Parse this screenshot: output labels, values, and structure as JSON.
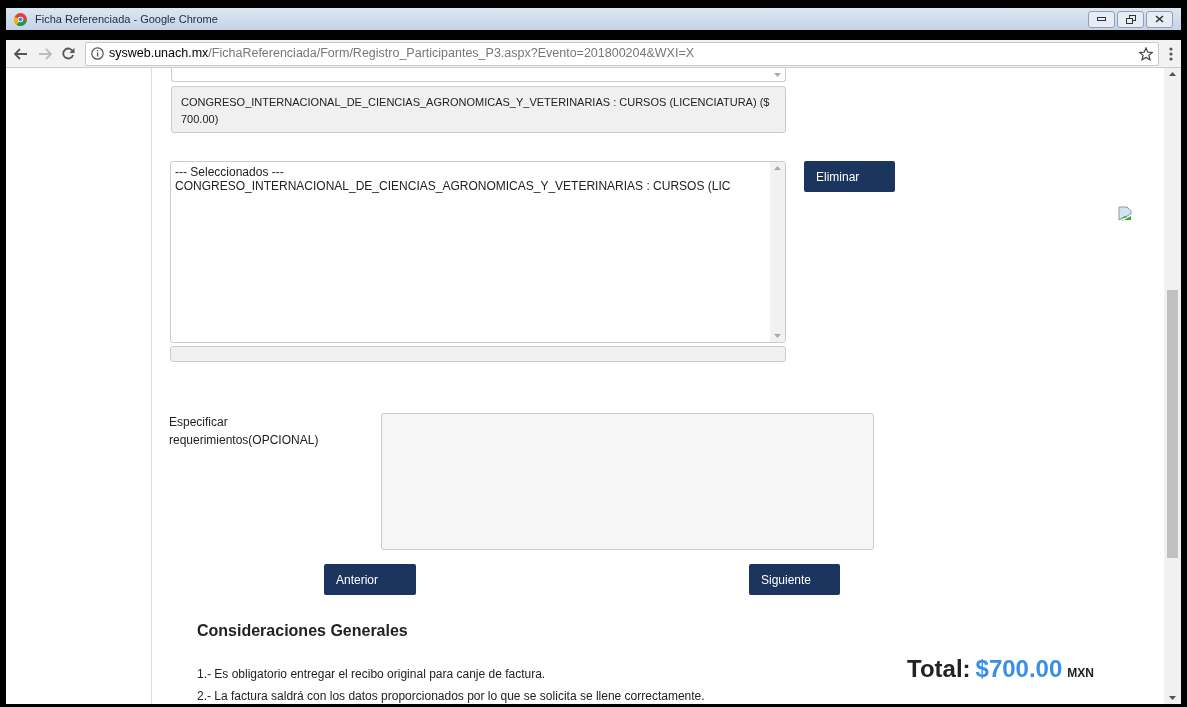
{
  "window": {
    "title": "Ficha Referenciada - Google Chrome"
  },
  "address_bar": {
    "host": "sysweb.unach.mx",
    "path": "/FichaReferenciada/Form/Registro_Participantes_P3.aspx?Evento=201800204&WXI=X"
  },
  "form": {
    "summary": "CONGRESO_INTERNACIONAL_DE_CIENCIAS_AGRONOMICAS_Y_VETERINARIAS : CURSOS (LICENCIATURA) ($ 700.00)",
    "selected_list": [
      "--- Seleccionados ---",
      "CONGRESO_INTERNACIONAL_DE_CIENCIAS_AGRONOMICAS_Y_VETERINARIAS : CURSOS (LIC"
    ],
    "delete_button": "Eliminar",
    "requirements_label": "Especificar requerimientos(OPCIONAL)",
    "back_button": "Anterior",
    "next_button": "Siguiente"
  },
  "considerations": {
    "title": "Consideraciones Generales",
    "items": [
      "1.- Es obligatorio entregar el recibo original para canje de factura.",
      "2.- La factura saldrá con los datos proporcionados por lo que se solicita se llene correctamente."
    ]
  },
  "total": {
    "label": "Total:",
    "amount": "$700.00",
    "currency": "MXN"
  }
}
